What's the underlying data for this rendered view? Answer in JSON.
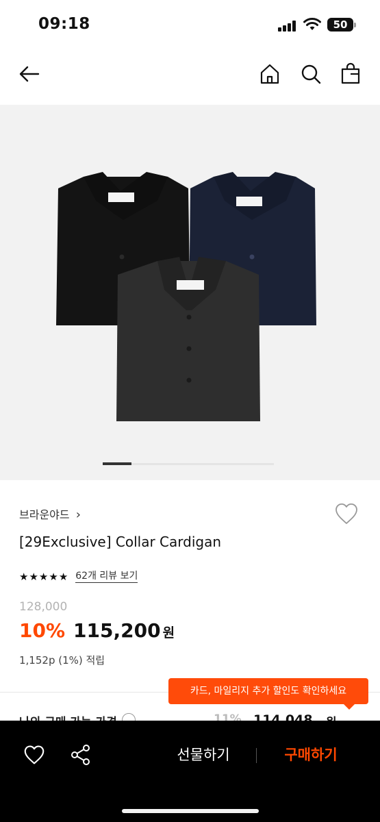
{
  "status_bar": {
    "time": "09:18",
    "battery": "50"
  },
  "nav": {
    "back_icon": "arrow-left-icon",
    "home_icon": "home-icon",
    "search_icon": "search-icon",
    "cart_icon": "shopping-bag-icon"
  },
  "gallery": {
    "image_description": "three knit collar cardigans: black, navy, charcoal",
    "current_slide": 1
  },
  "product": {
    "brand": "브라운야드",
    "brand_chevron": "›",
    "name": "[29Exclusive] Collar Cardigan",
    "stars": 5,
    "review_link": "62개 리뷰 보기",
    "original_price": "128,000",
    "discount_rate": "10%",
    "sale_price": "115,200",
    "currency": "원",
    "points": "1,152p (1%) 적립"
  },
  "tooltip": {
    "text": "카드, 마일리지 추가 할인도 확인하세요"
  },
  "my_price_row": {
    "label": "나의 구매 가능 가격",
    "discount": "11%",
    "price": "114,048",
    "currency": "원"
  },
  "bottom_bar": {
    "gift_label": "선물하기",
    "buy_label": "구매하기",
    "accent": "#ff4800"
  },
  "colors": {
    "accent": "#ff4800",
    "tooltip": "#ff4b0a",
    "background": "#ffffff"
  }
}
